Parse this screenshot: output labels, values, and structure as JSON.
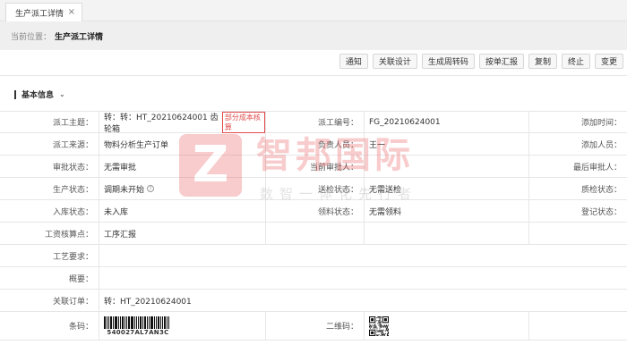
{
  "tab": {
    "label": "生产派工详情",
    "close": "×"
  },
  "breadcrumb": {
    "label": "当前位置：",
    "current": "生产派工详情"
  },
  "toolbar": [
    "通知",
    "关联设计",
    "生成周转码",
    "按单汇报",
    "复制",
    "终止",
    "变更"
  ],
  "section": {
    "title": "基本信息",
    "chevron": "⌄"
  },
  "fields": {
    "dispatch_subject_label": "派工主题：",
    "dispatch_subject": "转：转：HT_20210624001 齿轮箱",
    "cost_badge": "部分成本核算",
    "dispatch_no_label": "派工编号：",
    "dispatch_no": "FG_20210624001",
    "add_time_label": "添加时间：",
    "source_label": "派工来源：",
    "source": "物料分析生产订单",
    "responsible_label": "负责人员：",
    "responsible": "王一",
    "add_person_label": "添加人员：",
    "review_status_label": "审批状态：",
    "review_status": "无需审批",
    "current_reviewer_label": "当前审批人：",
    "last_reviewer_label": "最后审批人：",
    "prod_status_label": "生产状态：",
    "prod_status": "调期未开始",
    "send_check_label": "送检状态：",
    "send_check": "无需送检",
    "qc_status_label": "质检状态：",
    "stock_status_label": "入库状态：",
    "stock_status": "未入库",
    "material_status_label": "领料状态：",
    "material_status": "无需领料",
    "register_status_label": "登记状态：",
    "wage_point_label": "工资核算点：",
    "wage_point": "工序汇报",
    "process_req_label": "工艺要求：",
    "summary_label": "概要：",
    "linked_order_label": "关联订单：",
    "linked_order": "转：HT_20210624001",
    "barcode_label": "条码：",
    "barcode_value": "540027AL7AN3C",
    "qrcode_label": "二维码："
  },
  "watermark": {
    "name": "智邦国际",
    "slogan": "数智一体化先行者",
    "logo_letter": "Z"
  },
  "colors": {
    "badge": "#e24b4b",
    "watermark": "#e8484a"
  }
}
